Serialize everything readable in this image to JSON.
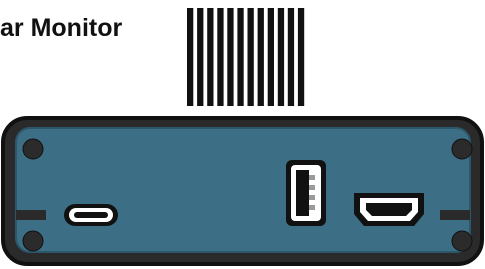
{
  "title": "ar Monitor",
  "illustration": {
    "subject": "device-side-panel",
    "colors": {
      "case_outline": "#111111",
      "case_fill": "#2a2a2a",
      "panel_fill": "#3c6e86",
      "panel_edge": "#2c566a",
      "screw": "#2b2b2b",
      "port_body": "#ffffff",
      "port_slot": "#111111",
      "heatsink_fin": "#111111"
    },
    "ports": [
      "micro-usb-port",
      "usb-a-port",
      "hdmi-port"
    ],
    "screws": 4,
    "heatsink_fins": 12
  }
}
